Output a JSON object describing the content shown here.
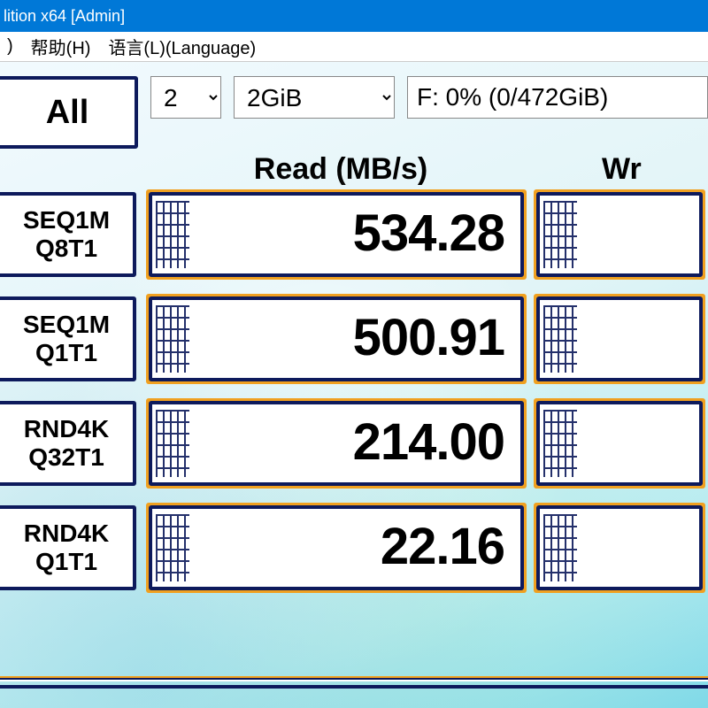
{
  "window": {
    "title": "lition x64 [Admin]"
  },
  "menu": {
    "help": "帮助(H)",
    "language": "语言(L)(Language)",
    "close_paren": ")"
  },
  "controls": {
    "all_label": "All",
    "count_value": "2",
    "size_value": "2GiB",
    "drive_text": "F: 0% (0/472GiB)"
  },
  "headers": {
    "read": "Read (MB/s)",
    "write": "Wr"
  },
  "tests": [
    {
      "line1": "SEQ1M",
      "line2": "Q8T1",
      "read": "534.28"
    },
    {
      "line1": "SEQ1M",
      "line2": "Q1T1",
      "read": "500.91"
    },
    {
      "line1": "RND4K",
      "line2": "Q32T1",
      "read": "214.00"
    },
    {
      "line1": "RND4K",
      "line2": "Q1T1",
      "read": "22.16"
    }
  ]
}
